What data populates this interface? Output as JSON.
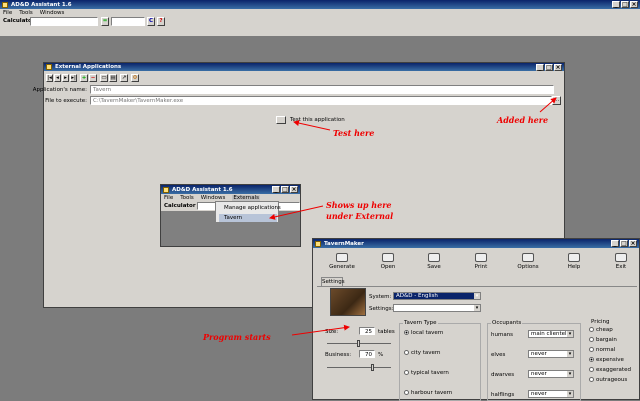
{
  "main": {
    "title": "AD&D Assistant 1.6",
    "menu": [
      "File",
      "Tools",
      "Windows"
    ],
    "calc_label": "Calculator",
    "calc_eq": "=",
    "calc_c": "C",
    "calc_help": "?"
  },
  "ext": {
    "title": "External Applications",
    "app_name_label": "Application's name:",
    "app_name": "Tavern",
    "file_label": "File to execute:",
    "file_path": "C:\\TavernMaker\\TavernMaker.exe",
    "test_label": "Test this application"
  },
  "mini": {
    "title": "AD&D Assistant 1.6",
    "menu": [
      "File",
      "Tools",
      "Windows",
      "Externals"
    ],
    "calc_label": "Calculator",
    "dropdown": [
      "Manage applications",
      "Tavern"
    ]
  },
  "tm": {
    "title": "TavernMaker",
    "toolbar": [
      "Generate",
      "Open",
      "Save",
      "Print",
      "Options",
      "Help",
      "Exit"
    ],
    "tab": "Settings",
    "system_label": "System:",
    "system_value": "AD&D - English",
    "settings_label": "Settings:",
    "size_label": "Size:",
    "size_value": "25",
    "size_unit": "tables",
    "business_label": "Business:",
    "business_value": "70",
    "business_unit": "%",
    "tavern_type_title": "Tavern Type",
    "tavern_types": [
      "local tavern",
      "city tavern",
      "typical tavern",
      "harbour tavern"
    ],
    "occupants_title": "Occupants",
    "occupants": [
      {
        "label": "humans",
        "value": "main clientel"
      },
      {
        "label": "elves",
        "value": "never"
      },
      {
        "label": "dwarves",
        "value": "never"
      },
      {
        "label": "halflings",
        "value": "never"
      }
    ],
    "pricing_title": "Pricing",
    "pricing": [
      "cheap",
      "bargain",
      "normal",
      "expensive",
      "exaggerated",
      "outrageous"
    ]
  },
  "annotations": {
    "test": "Test here",
    "added": "Added here",
    "shows1": "Shows up here",
    "shows2": "under External",
    "starts": "Program starts"
  },
  "colors": {
    "annotation": "#e00000",
    "titlebar": "#0a246a",
    "desktop": "#7c7c7c"
  }
}
